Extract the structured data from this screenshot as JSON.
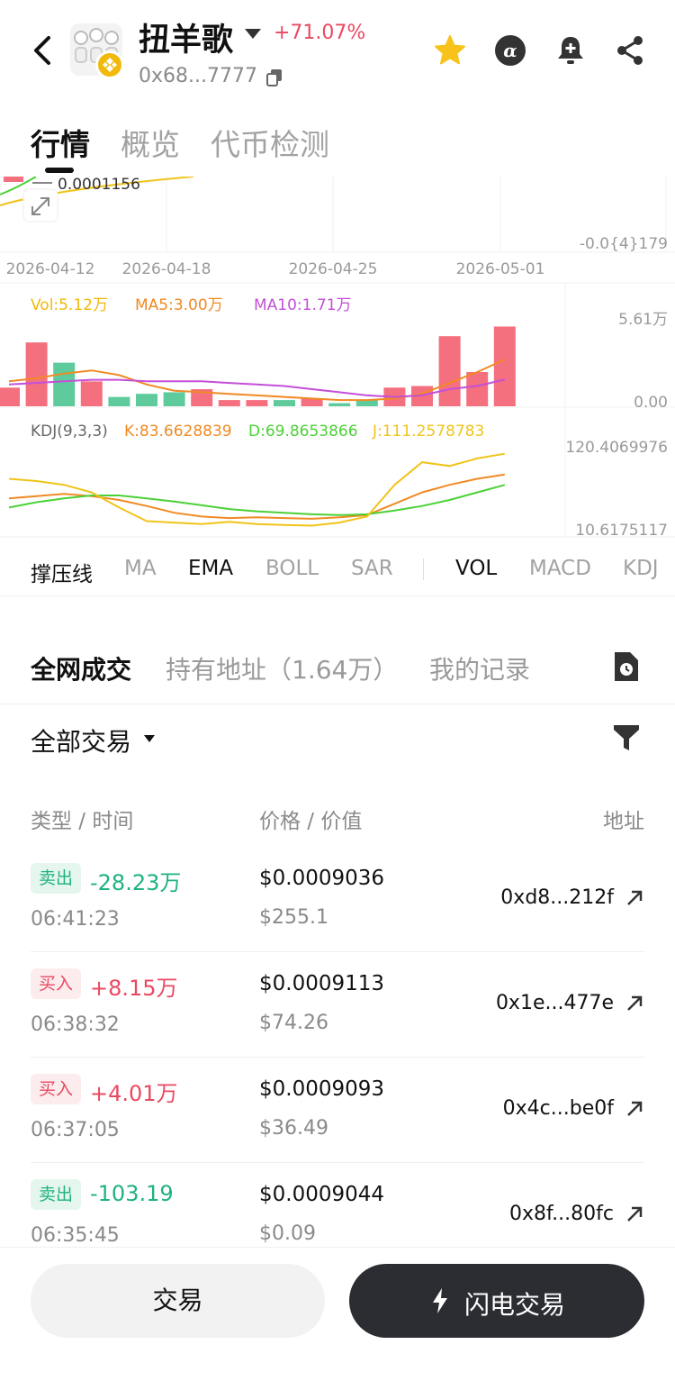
{
  "header": {
    "token_name": "扭羊歌",
    "change": "+71.07%",
    "address": "0x68...7777"
  },
  "tabs": [
    "行情",
    "概览",
    "代币检测"
  ],
  "chart": {
    "top_price_label": "0.0001156",
    "price_axis_low": "-0.0{4}179",
    "dates": [
      "2026-04-12",
      "2026-04-18",
      "2026-04-25",
      "2026-05-01"
    ],
    "vol_legend": {
      "vol": "Vol:5.12万",
      "ma5": "MA5:3.00万",
      "ma10": "MA10:1.71万"
    },
    "vol_axis": {
      "max": "5.61万",
      "min": "0.00"
    },
    "kdj_legend": {
      "name": "KDJ(9,3,3)",
      "k": "K:83.6628839",
      "d": "D:69.8653866",
      "j": "J:111.2578783"
    },
    "kdj_axis": {
      "max": "120.4069976",
      "min": "10.6175117"
    },
    "colors": {
      "up": "#F4707E",
      "down": "#5FCB9C",
      "vol": "#F0B90B",
      "ma5": "#F08A24",
      "ma10": "#C44FD8",
      "k": "#F08A24",
      "d": "#4CD137",
      "j": "#F0C419"
    }
  },
  "chart_data": {
    "type": "bar",
    "title": "",
    "xlabel": "",
    "ylabel": "",
    "volume_bars": [
      {
        "value": 1.2,
        "dir": "up"
      },
      {
        "value": 4.1,
        "dir": "up"
      },
      {
        "value": 2.8,
        "dir": "down"
      },
      {
        "value": 1.6,
        "dir": "up"
      },
      {
        "value": 0.6,
        "dir": "down"
      },
      {
        "value": 0.8,
        "dir": "down"
      },
      {
        "value": 0.9,
        "dir": "down"
      },
      {
        "value": 1.1,
        "dir": "up"
      },
      {
        "value": 0.4,
        "dir": "up"
      },
      {
        "value": 0.4,
        "dir": "up"
      },
      {
        "value": 0.4,
        "dir": "down"
      },
      {
        "value": 0.5,
        "dir": "up"
      },
      {
        "value": 0.2,
        "dir": "down"
      },
      {
        "value": 0.4,
        "dir": "down"
      },
      {
        "value": 1.2,
        "dir": "up"
      },
      {
        "value": 1.3,
        "dir": "up"
      },
      {
        "value": 4.5,
        "dir": "up"
      },
      {
        "value": 2.2,
        "dir": "up"
      },
      {
        "value": 5.12,
        "dir": "up"
      }
    ],
    "ylim_volume": [
      0,
      5.61
    ],
    "series": [
      {
        "name": "MA5",
        "values": [
          1.6,
          1.8,
          2.1,
          2.3,
          2.0,
          1.4,
          1.0,
          0.9,
          0.8,
          0.7,
          0.6,
          0.5,
          0.4,
          0.4,
          0.5,
          0.8,
          1.5,
          2.2,
          3.0
        ]
      },
      {
        "name": "MA10",
        "values": [
          1.4,
          1.5,
          1.6,
          1.7,
          1.7,
          1.6,
          1.6,
          1.6,
          1.5,
          1.4,
          1.3,
          1.1,
          0.9,
          0.7,
          0.6,
          0.7,
          1.1,
          1.3,
          1.71
        ]
      },
      {
        "name": "K",
        "values": [
          52,
          55,
          58,
          55,
          50,
          42,
          33,
          28,
          26,
          27,
          26,
          25,
          27,
          30,
          45,
          60,
          70,
          78,
          83.66
        ]
      },
      {
        "name": "D",
        "values": [
          40,
          47,
          52,
          56,
          56,
          52,
          48,
          43,
          38,
          35,
          33,
          31,
          30,
          31,
          36,
          42,
          50,
          60,
          69.87
        ]
      },
      {
        "name": "J",
        "values": [
          78,
          75,
          70,
          60,
          40,
          22,
          20,
          18,
          21,
          18,
          17,
          16,
          20,
          28,
          70,
          100,
          95,
          105,
          111.26
        ]
      }
    ],
    "ylim_kdj": [
      10.6175117,
      120.4069976
    ]
  },
  "indicators": [
    "撑压线",
    "MA",
    "EMA",
    "BOLL",
    "SAR",
    "VOL",
    "MACD",
    "KDJ"
  ],
  "trade_tabs": {
    "all": "全网成交",
    "holders": "持有地址（1.64万）",
    "mine": "我的记录"
  },
  "filter": {
    "label": "全部交易"
  },
  "columns": {
    "type_time": "类型 / 时间",
    "price_value": "价格 / 价值",
    "address": "地址"
  },
  "rows": [
    {
      "type": "卖出",
      "amount": "-28.23万",
      "time": "06:41:23",
      "price": "$0.0009036",
      "value": "$255.1",
      "address": "0xd8...212f"
    },
    {
      "type": "买入",
      "amount": "+8.15万",
      "time": "06:38:32",
      "price": "$0.0009113",
      "value": "$74.26",
      "address": "0x1e...477e"
    },
    {
      "type": "买入",
      "amount": "+4.01万",
      "time": "06:37:05",
      "price": "$0.0009093",
      "value": "$36.49",
      "address": "0x4c...be0f"
    },
    {
      "type": "卖出",
      "amount": "-103.19",
      "time": "06:35:45",
      "price": "$0.0009044",
      "value": "$0.09",
      "address": "0x8f...80fc"
    }
  ],
  "bottom": {
    "trade": "交易",
    "flash": "闪电交易"
  }
}
